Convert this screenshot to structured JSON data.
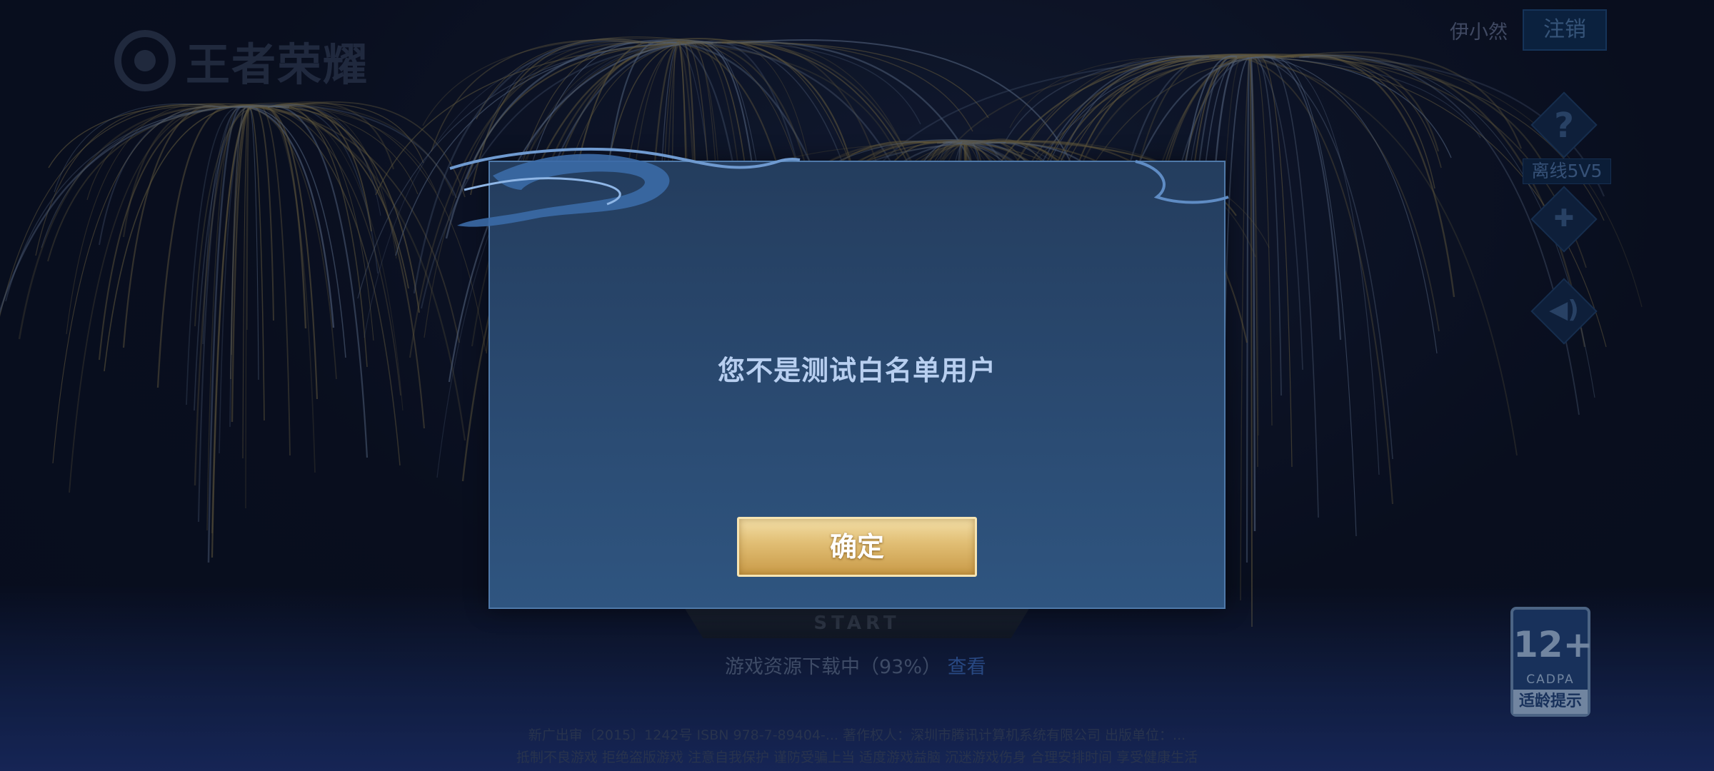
{
  "brand": {
    "logo_text": "王者荣耀"
  },
  "header": {
    "user_name": "伊小然",
    "logout_label": "注销"
  },
  "side_menu": {
    "help_glyph": "?",
    "offline_label": "离线5V5",
    "gamepad_glyph": "✚",
    "sound_glyph": "◀)"
  },
  "start": {
    "label": "START"
  },
  "download": {
    "status_text": "游戏资源下载中（93%）",
    "view_label": "查看",
    "progress_percent": 93
  },
  "footer": {
    "line1": "新广出审〔2015〕1242号 ISBN 978-7-89404-... 著作权人：深圳市腾讯计算机系统有限公司 出版单位：...",
    "line2": "抵制不良游戏 拒绝盗版游戏 注意自我保护 谨防受骗上当 适度游戏益脑 沉迷游戏伤身 合理安排时间 享受健康生活"
  },
  "age_rating": {
    "number": "12+",
    "org": "CADPA",
    "tip": "适龄提示"
  },
  "dialog": {
    "message": "您不是测试白名单用户",
    "confirm_label": "确定"
  },
  "colors": {
    "dialog_bg": "#2a4a71",
    "confirm_gold": "#e2c077",
    "background": "#0c1122"
  }
}
